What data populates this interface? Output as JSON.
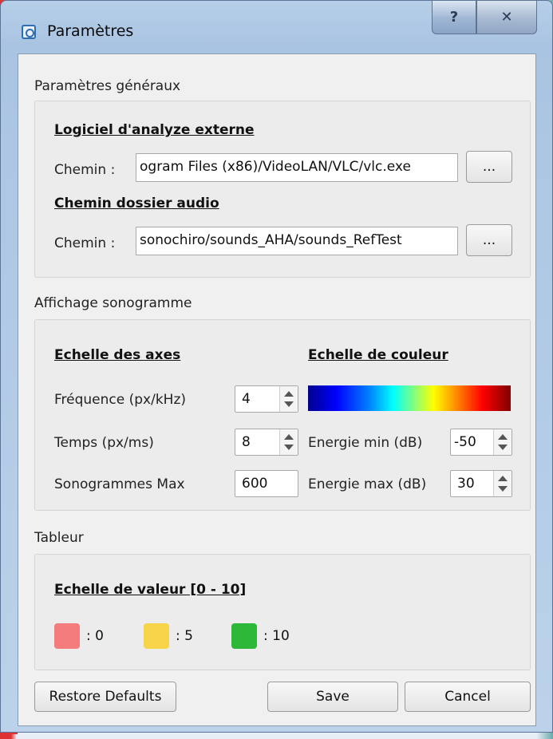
{
  "window": {
    "title": "Paramètres",
    "help_label": "?",
    "close_label": "✕"
  },
  "general": {
    "section_label": "Paramètres généraux",
    "external_heading": "Logiciel d'analyze externe",
    "external_path_label": "Chemin :",
    "external_path_value": "ogram Files (x86)/VideoLAN/VLC/vlc.exe",
    "external_browse_label": "...",
    "audio_heading": "Chemin dossier audio",
    "audio_path_label": "Chemin :",
    "audio_path_value": "sonochiro/sounds_AHA/sounds_RefTest",
    "audio_browse_label": "..."
  },
  "sonogram": {
    "section_label": "Affichage sonogramme",
    "axes_heading": "Echelle des axes",
    "color_heading": "Echelle de couleur",
    "frequency_label": "Fréquence (px/kHz)",
    "frequency_value": "4",
    "time_label": "Temps (px/ms)",
    "time_value": "8",
    "max_label": "Sonogrammes Max",
    "max_value": "600",
    "energy_min_label": "Energie min (dB)",
    "energy_min_value": "-50",
    "energy_max_label": "Energie max (dB)",
    "energy_max_value": "30"
  },
  "table": {
    "section_label": "Tableur",
    "scale_heading": "Echelle de valeur [0 - 10]",
    "swatches": [
      {
        "label": ": 0",
        "color": "#f47c7c"
      },
      {
        "label": ": 5",
        "color": "#f8d44a"
      },
      {
        "label": ": 10",
        "color": "#2db83a"
      }
    ]
  },
  "footer": {
    "restore_label": "Restore Defaults",
    "save_label": "Save",
    "cancel_label": "Cancel"
  }
}
